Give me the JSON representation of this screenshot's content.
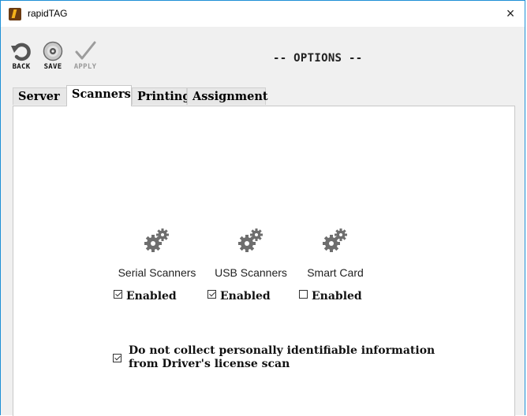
{
  "window": {
    "title": "rapidTAG",
    "close_glyph": "×"
  },
  "toolbar": {
    "back_label": "BACK",
    "save_label": "SAVE",
    "apply_label": "APPLY",
    "title": "-- OPTIONS --"
  },
  "tabs": [
    {
      "label": "Server",
      "active": false
    },
    {
      "label": "Scanners",
      "active": true
    },
    {
      "label": "Printing",
      "active": false
    },
    {
      "label": "Assignment",
      "active": false
    }
  ],
  "scanners": [
    {
      "label": "Serial Scanners",
      "enabled_label": "Enabled",
      "enabled": true,
      "icon": "gears-icon"
    },
    {
      "label": "USB Scanners",
      "enabled_label": "Enabled",
      "enabled": true,
      "icon": "gears-icon"
    },
    {
      "label": "Smart Card",
      "enabled_label": "Enabled",
      "enabled": false,
      "icon": "gears-icon"
    }
  ],
  "pii": {
    "checked": true,
    "line1": "Do not collect personally identifiable information",
    "line2": "from Driver's license scan"
  }
}
